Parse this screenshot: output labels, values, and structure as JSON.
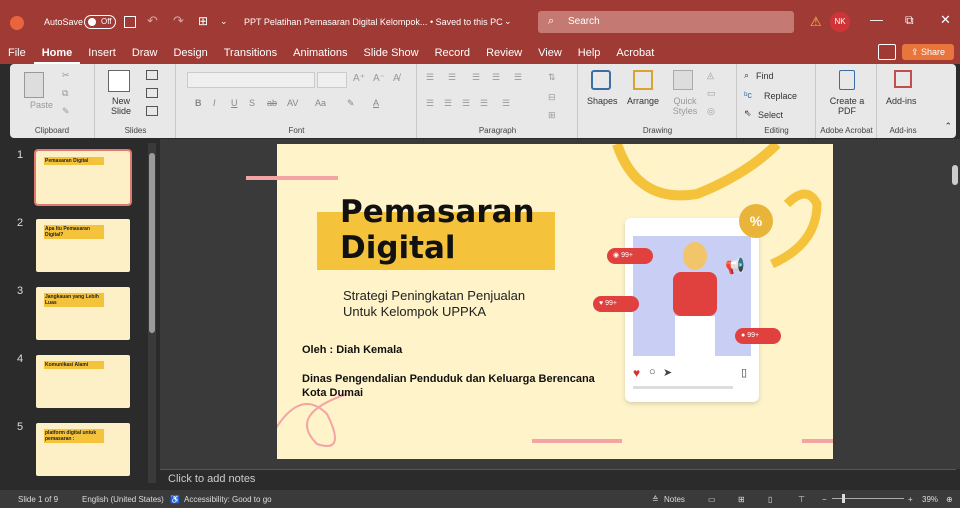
{
  "window": {
    "autosave_label": "AutoSave",
    "autosave_state": "Off",
    "doc_title": "PPT Pelatihan Pemasaran Digital Kelompok...",
    "save_status": "• Saved to this PC",
    "search_placeholder": "Search",
    "user_initials": "NK"
  },
  "tabs": [
    "File",
    "Home",
    "Insert",
    "Draw",
    "Design",
    "Transitions",
    "Animations",
    "Slide Show",
    "Record",
    "Review",
    "View",
    "Help",
    "Acrobat"
  ],
  "share_label": "Share",
  "ribbon": {
    "clipboard": {
      "paste": "Paste",
      "label": "Clipboard"
    },
    "slides": {
      "new_slide": "New Slide",
      "label": "Slides"
    },
    "font": {
      "label": "Font",
      "b": "B",
      "i": "I",
      "u": "U",
      "s": "S",
      "ab": "ab",
      "av": "AV",
      "aa": "Aa",
      "a": "A"
    },
    "paragraph": {
      "label": "Paragraph"
    },
    "drawing": {
      "shapes": "Shapes",
      "arrange": "Arrange",
      "quick_styles": "Quick Styles",
      "label": "Drawing"
    },
    "editing": {
      "find": "Find",
      "replace": "Replace",
      "select": "Select",
      "label": "Editing"
    },
    "acrobat": {
      "create_pdf": "Create a PDF",
      "label": "Adobe Acrobat"
    },
    "addins": {
      "addins": "Add-ins",
      "label": "Add-ins"
    }
  },
  "thumbnails": [
    {
      "num": "1",
      "title": "Pemasaran Digital"
    },
    {
      "num": "2",
      "title": "Apa Itu Pemasaran Digital?"
    },
    {
      "num": "3",
      "title": "Jangkauan yang Lebih Luas"
    },
    {
      "num": "4",
      "title": "Komunikasi Alami"
    },
    {
      "num": "5",
      "title": "platform digital untuk pemasaran :"
    }
  ],
  "slide": {
    "title_line1": "Pemasaran",
    "title_line2": "Digital",
    "subtitle_line1": "Strategi Peningkatan Penjualan",
    "subtitle_line2": "Untuk Kelompok UPPKA",
    "author": "Oleh : Diah Kemala",
    "org_line1": "Dinas Pengendalian Penduduk dan Keluarga Berencana",
    "org_line2": "Kota Dumai",
    "badge1": "99+",
    "badge2": "99+",
    "badge3": "99+",
    "percent": "%"
  },
  "notes_placeholder": "Click to add notes",
  "status": {
    "slide_count": "Slide 1 of 9",
    "language": "English (United States)",
    "accessibility": "Accessibility: Good to go",
    "notes": "Notes",
    "zoom": "39%"
  },
  "colors": {
    "accent": "#b64a3d",
    "slide_bg": "#fef3c9",
    "yellow": "#f5c33b",
    "pink": "#f4a4a4"
  }
}
